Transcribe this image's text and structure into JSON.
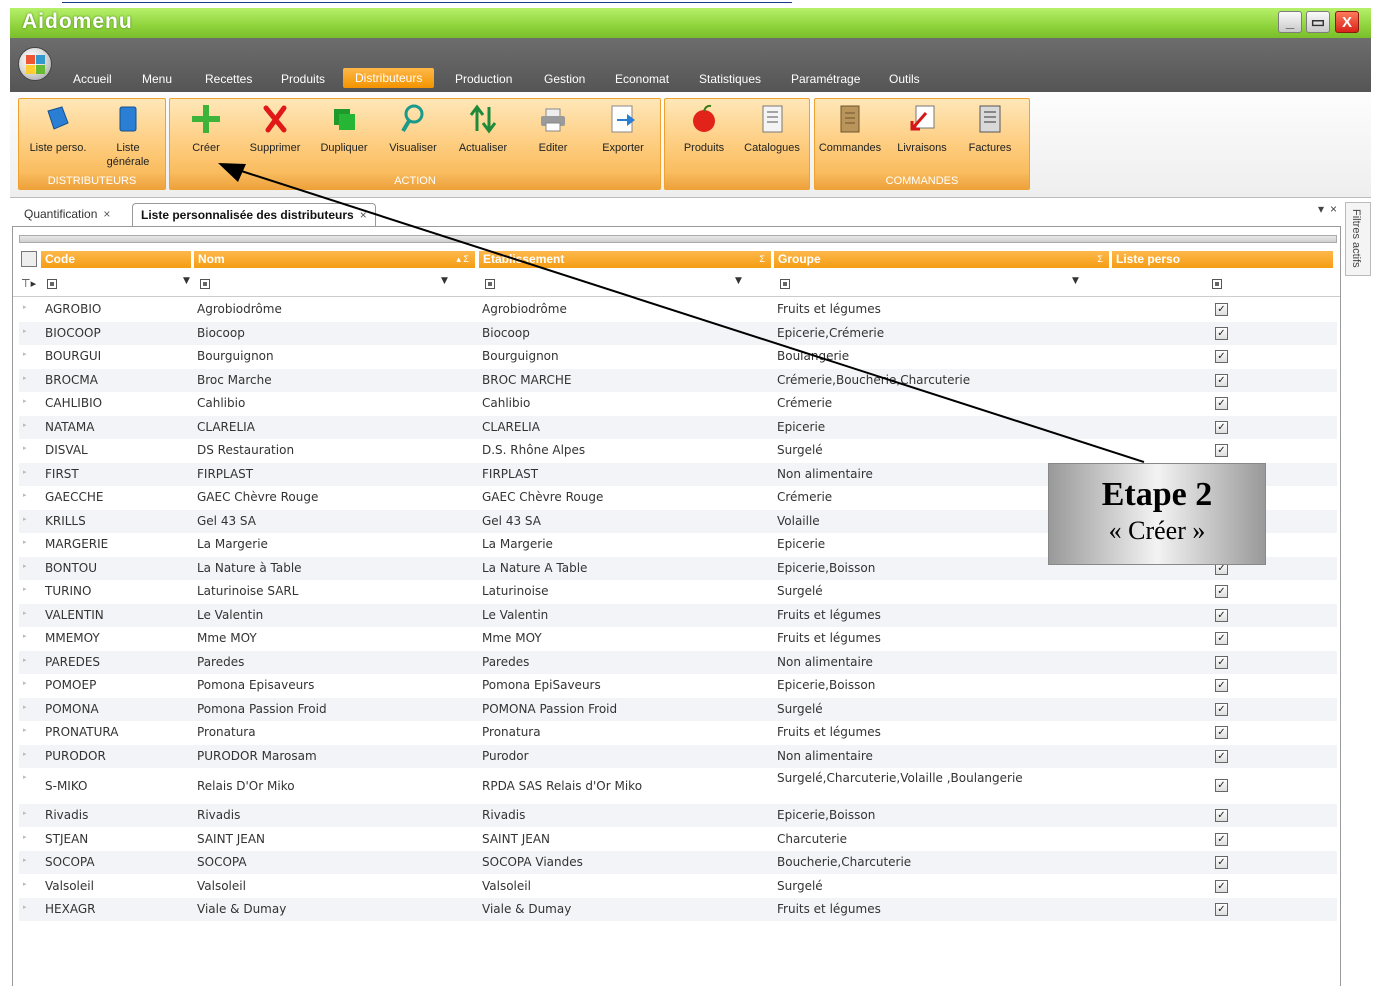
{
  "app": {
    "title": "Aidomenu"
  },
  "window_buttons": {
    "minimize": "_",
    "maximize": "▭",
    "close": "X"
  },
  "menu": [
    {
      "label": "Accueil"
    },
    {
      "label": "Menu"
    },
    {
      "label": "Recettes"
    },
    {
      "label": "Produits"
    },
    {
      "label": "Distributeurs",
      "active": true
    },
    {
      "label": "Production"
    },
    {
      "label": "Gestion"
    },
    {
      "label": "Economat"
    },
    {
      "label": "Statistiques"
    },
    {
      "label": "Paramétrage"
    },
    {
      "label": "Outils"
    }
  ],
  "ribbon": {
    "groups": [
      {
        "label": "DISTRIBUTEURS",
        "buttons": [
          {
            "label": "Liste perso.",
            "icon": "book-blue-icon"
          },
          {
            "label": "Liste générale",
            "icon": "book-blue-icon"
          }
        ]
      },
      {
        "label": "ACTION",
        "buttons": [
          {
            "label": "Créer",
            "icon": "plus-icon"
          },
          {
            "label": "Supprimer",
            "icon": "delete-x-icon"
          },
          {
            "label": "Dupliquer",
            "icon": "duplicate-icon"
          },
          {
            "label": "Visualiser",
            "icon": "magnifier-icon"
          },
          {
            "label": "Actualiser",
            "icon": "refresh-arrows-icon"
          },
          {
            "label": "Editer",
            "icon": "printer-icon"
          },
          {
            "label": "Exporter",
            "icon": "export-icon"
          }
        ]
      },
      {
        "label": "",
        "buttons": [
          {
            "label": "Produits",
            "icon": "apple-icon"
          },
          {
            "label": "Catalogues",
            "icon": "catalog-icon"
          }
        ]
      },
      {
        "label": "COMMANDES",
        "buttons": [
          {
            "label": "Commandes",
            "icon": "order-icon"
          },
          {
            "label": "Livraisons",
            "icon": "delivery-icon"
          },
          {
            "label": "Factures",
            "icon": "invoice-icon"
          }
        ]
      }
    ]
  },
  "tabs": [
    {
      "label": "Quantification",
      "close": "×"
    },
    {
      "label": "Liste personnalisée des distributeurs",
      "close": "×",
      "active": true
    }
  ],
  "pane_controls": {
    "pin": "▾",
    "close": "×"
  },
  "side_panel": {
    "label": "Filtres actifs"
  },
  "grid": {
    "columns": [
      "Code",
      "Nom",
      "Etablissement",
      "Groupe",
      "Liste perso"
    ],
    "rows": [
      {
        "code": "AGROBIO",
        "nom": "Agrobiodrôme",
        "etab": "Agrobiodrôme",
        "groupe": "Fruits et légumes",
        "perso": true
      },
      {
        "code": "BIOCOOP",
        "nom": "Biocoop",
        "etab": "Biocoop",
        "groupe": "Epicerie,Crémerie",
        "perso": true
      },
      {
        "code": "BOURGUI",
        "nom": "Bourguignon",
        "etab": "Bourguignon",
        "groupe": "Boulangerie",
        "perso": true
      },
      {
        "code": "BROCMA",
        "nom": "Broc Marche",
        "etab": "BROC MARCHE",
        "groupe": "Crémerie,Boucherie,Charcuterie",
        "perso": true
      },
      {
        "code": "CAHLIBIO",
        "nom": "Cahlibio",
        "etab": "Cahlibio",
        "groupe": "Crémerie",
        "perso": true
      },
      {
        "code": "NATAMA",
        "nom": "CLARELIA",
        "etab": "CLARELIA",
        "groupe": "Epicerie",
        "perso": true
      },
      {
        "code": "DISVAL",
        "nom": "DS Restauration",
        "etab": "D.S. Rhône Alpes",
        "groupe": "Surgelé",
        "perso": true
      },
      {
        "code": "FIRST",
        "nom": "FIRPLAST",
        "etab": "FIRPLAST",
        "groupe": "Non alimentaire",
        "perso": true
      },
      {
        "code": "GAECCHE",
        "nom": "GAEC Chèvre Rouge",
        "etab": "GAEC Chèvre Rouge",
        "groupe": "Crémerie",
        "perso": true
      },
      {
        "code": "KRILLS",
        "nom": "Gel 43 SA",
        "etab": "Gel 43 SA",
        "groupe": "Volaille",
        "perso": true
      },
      {
        "code": "MARGERIE",
        "nom": "La Margerie",
        "etab": "La Margerie",
        "groupe": "Epicerie",
        "perso": true
      },
      {
        "code": "BONTOU",
        "nom": "La Nature à Table",
        "etab": "La Nature A Table",
        "groupe": "Epicerie,Boisson",
        "perso": true
      },
      {
        "code": "TURINO",
        "nom": "Laturinoise SARL",
        "etab": "Laturinoise",
        "groupe": "Surgelé",
        "perso": true
      },
      {
        "code": "VALENTIN",
        "nom": "Le Valentin",
        "etab": "Le Valentin",
        "groupe": "Fruits et légumes",
        "perso": true
      },
      {
        "code": "MMEMOY",
        "nom": "Mme MOY",
        "etab": "Mme MOY",
        "groupe": "Fruits et légumes",
        "perso": true
      },
      {
        "code": "PAREDES",
        "nom": "Paredes",
        "etab": "Paredes",
        "groupe": "Non alimentaire",
        "perso": true
      },
      {
        "code": "POMOEP",
        "nom": "Pomona Episaveurs",
        "etab": "Pomona EpiSaveurs",
        "groupe": "Epicerie,Boisson",
        "perso": true
      },
      {
        "code": "POMONA",
        "nom": "Pomona Passion Froid",
        "etab": "POMONA Passion Froid",
        "groupe": "Surgelé",
        "perso": true
      },
      {
        "code": "PRONATURA",
        "nom": "Pronatura",
        "etab": "Pronatura",
        "groupe": "Fruits et légumes",
        "perso": true
      },
      {
        "code": "PURODOR",
        "nom": "PURODOR Marosam",
        "etab": "Purodor",
        "groupe": "Non alimentaire",
        "perso": true
      },
      {
        "code": "S-MIKO",
        "nom": "Relais D'Or Miko",
        "etab": "RPDA SAS Relais d'Or Miko",
        "groupe": "Surgelé,Charcuterie,Volaille ,Boulangerie",
        "perso": true
      },
      {
        "code": "Rivadis",
        "nom": "Rivadis",
        "etab": "Rivadis",
        "groupe": "Epicerie,Boisson",
        "perso": true
      },
      {
        "code": "STJEAN",
        "nom": "SAINT JEAN",
        "etab": "SAINT JEAN",
        "groupe": "Charcuterie",
        "perso": true
      },
      {
        "code": "SOCOPA",
        "nom": "SOCOPA",
        "etab": "SOCOPA Viandes",
        "groupe": "Boucherie,Charcuterie",
        "perso": true
      },
      {
        "code": "Valsoleil",
        "nom": "Valsoleil",
        "etab": "Valsoleil",
        "groupe": "Surgelé",
        "perso": true
      },
      {
        "code": "HEXAGR",
        "nom": "Viale & Dumay",
        "etab": "Viale & Dumay",
        "groupe": "Fruits et légumes",
        "perso": true
      }
    ]
  },
  "callout": {
    "title": "Etape 2",
    "subtitle": "« Créer »"
  }
}
